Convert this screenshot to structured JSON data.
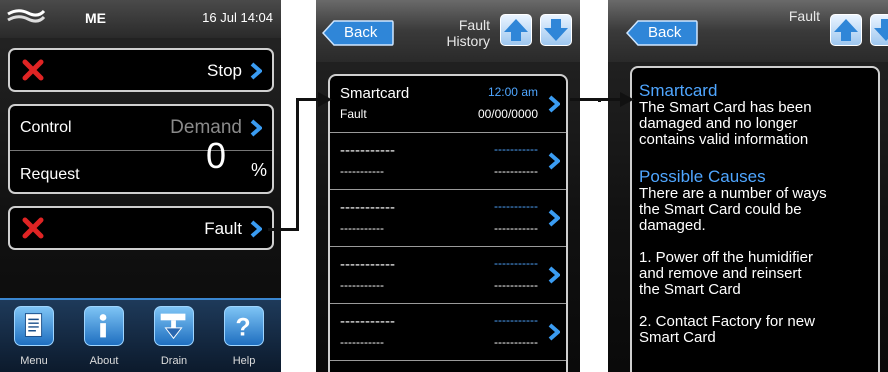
{
  "screen1": {
    "device": "ME",
    "datetime": "16 Jul 14:04",
    "status": {
      "label": "Stop"
    },
    "control": {
      "label": "Control",
      "value": "Demand"
    },
    "request": {
      "label": "Request",
      "value": "0",
      "unit": "%"
    },
    "fault": {
      "label": "Fault"
    },
    "nav": [
      {
        "label": "Menu",
        "icon": "document-icon"
      },
      {
        "label": "About",
        "icon": "info-icon"
      },
      {
        "label": "Drain",
        "icon": "drain-icon"
      },
      {
        "label": "Help",
        "icon": "question-icon"
      }
    ]
  },
  "screen2": {
    "back_label": "Back",
    "title_line1": "Fault",
    "title_line2": "History",
    "rows": [
      {
        "name": "Smartcard",
        "sub": "Fault",
        "time": "12:00 am",
        "date": "00/00/0000"
      },
      {
        "name": "-----------",
        "sub": "-----------",
        "time": "-----------",
        "date": "-----------"
      },
      {
        "name": "-----------",
        "sub": "-----------",
        "time": "-----------",
        "date": "-----------"
      },
      {
        "name": "-----------",
        "sub": "-----------",
        "time": "-----------",
        "date": "-----------"
      },
      {
        "name": "-----------",
        "sub": "-----------",
        "time": "-----------",
        "date": "-----------"
      }
    ]
  },
  "screen3": {
    "back_label": "Back",
    "title": "Fault",
    "heading1": "Smartcard",
    "body1": "The Smart Card has been\ndamaged and no longer\ncontains valid information",
    "heading2": "Possible Causes",
    "body2": "There are a number of ways\nthe Smart Card could be\ndamaged.",
    "body3": "1. Power off the humidifier\nand remove     and reinsert\nthe Smart Card",
    "body4": "2. Contact Factory for new\nSmart Card"
  },
  "colors": {
    "accent": "#3a86d0",
    "link": "#4fa6ff",
    "x_red": "#e02424"
  }
}
